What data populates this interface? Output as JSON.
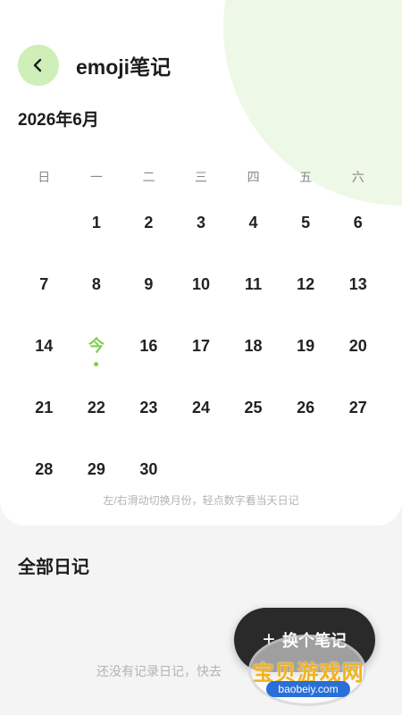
{
  "header": {
    "title": "emoji笔记",
    "back_icon": "chevron-left-icon"
  },
  "calendar": {
    "month_label": "2026年6月",
    "weekdays": [
      "日",
      "一",
      "二",
      "三",
      "四",
      "五",
      "六"
    ],
    "weeks": [
      [
        "",
        "1",
        "2",
        "3",
        "4",
        "5",
        "6"
      ],
      [
        "7",
        "8",
        "9",
        "10",
        "11",
        "12",
        "13"
      ],
      [
        "14",
        "今",
        "16",
        "17",
        "18",
        "19",
        "20"
      ],
      [
        "21",
        "22",
        "23",
        "24",
        "25",
        "26",
        "27"
      ],
      [
        "28",
        "29",
        "30",
        "",
        "",
        "",
        ""
      ]
    ],
    "today_label": "今",
    "hint": "左/右滑动切换月份，轻点数字看当天日记"
  },
  "notes": {
    "section_title": "全部日记",
    "empty_text": "还没有记录日记，快去"
  },
  "fab": {
    "plus": "+",
    "label": "换个笔记"
  },
  "watermark": {
    "text": "宝贝游戏网",
    "url": "baobeiy.com"
  },
  "colors": {
    "accent": "#7cd04d",
    "back_button_bg": "#cfeeb8",
    "fab_bg": "#2a2a2a",
    "deco": "#eef8e6"
  }
}
